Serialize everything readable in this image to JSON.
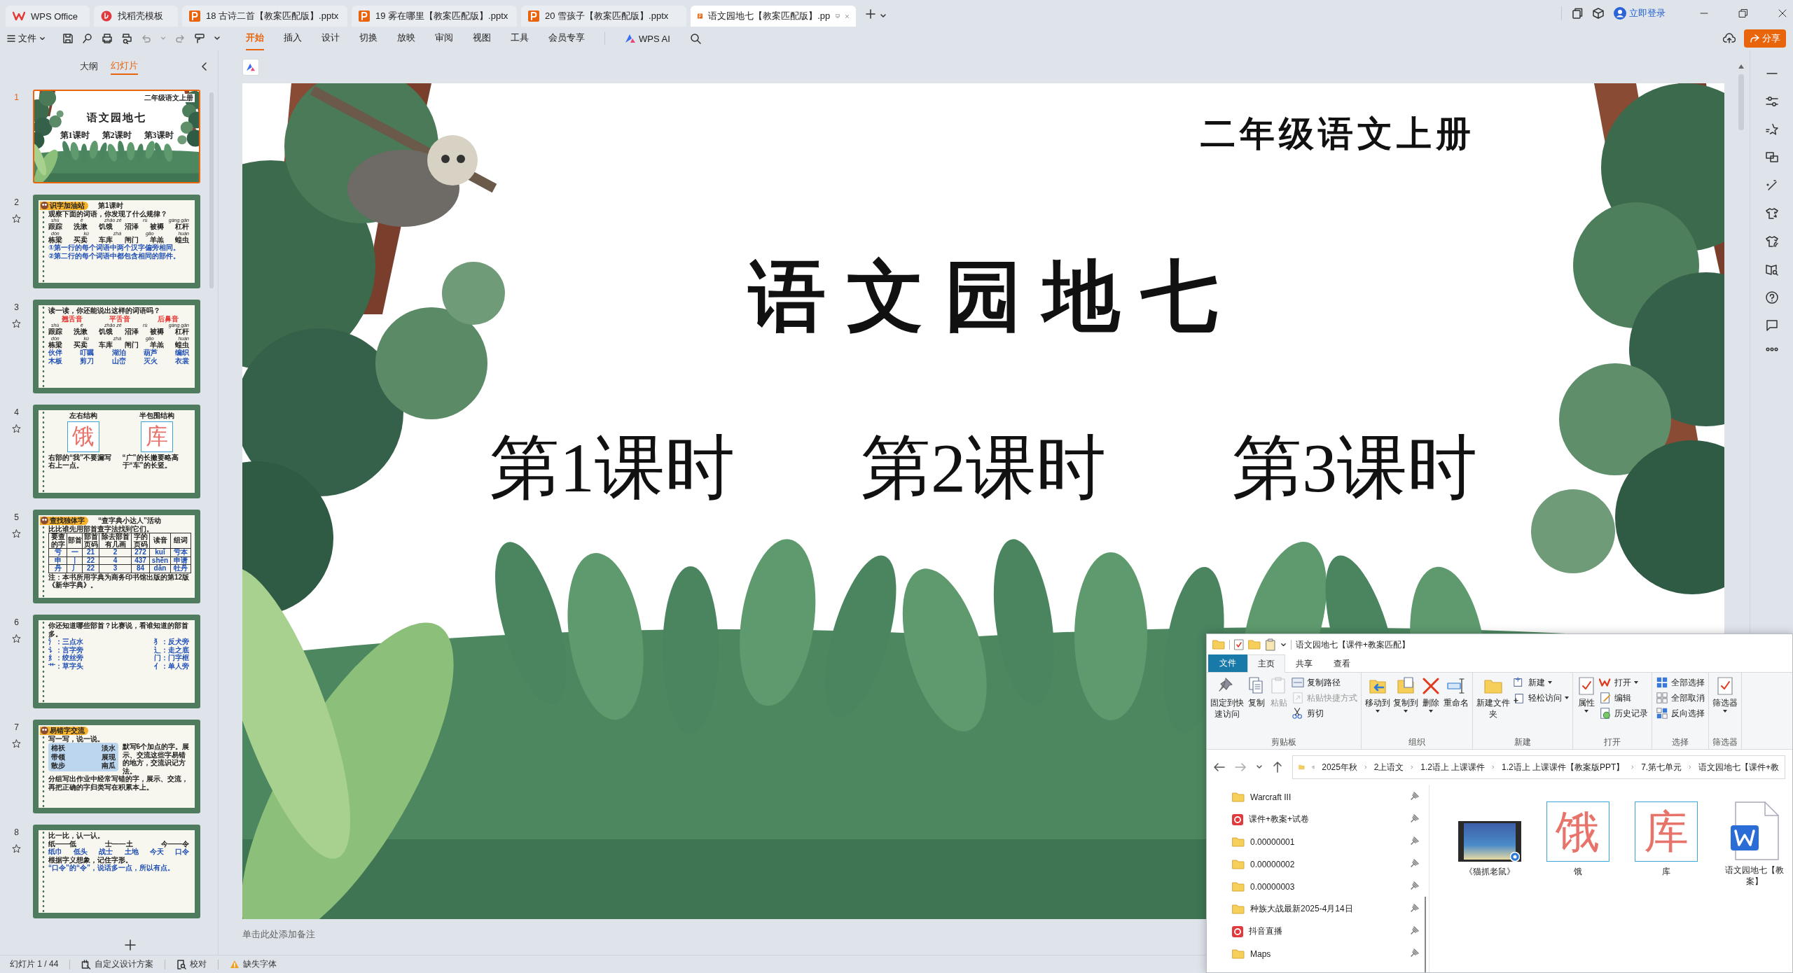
{
  "tabs": [
    {
      "label": "WPS Office",
      "kind": "home",
      "selected": false
    },
    {
      "label": "找稻壳模板",
      "kind": "docer",
      "selected": false
    },
    {
      "label": "18 古诗二首【教案匹配版】.pptx",
      "kind": "pptx",
      "selected": false
    },
    {
      "label": "19 雾在哪里【教案匹配版】.pptx",
      "kind": "pptx",
      "selected": false
    },
    {
      "label": "20 雪孩子【教案匹配版】.pptx",
      "kind": "pptx",
      "selected": false
    },
    {
      "label": "语文园地七【教案匹配版】.pp",
      "kind": "pptx",
      "selected": true
    }
  ],
  "account": {
    "login": "立即登录"
  },
  "menu": {
    "file": "文件",
    "tabs": [
      {
        "label": "开始",
        "selected": true
      },
      {
        "label": "插入",
        "selected": false
      },
      {
        "label": "设计",
        "selected": false
      },
      {
        "label": "切换",
        "selected": false
      },
      {
        "label": "放映",
        "selected": false
      },
      {
        "label": "审阅",
        "selected": false
      },
      {
        "label": "视图",
        "selected": false
      },
      {
        "label": "工具",
        "selected": false
      },
      {
        "label": "会员专享",
        "selected": false
      }
    ],
    "ai": "WPS AI",
    "share": "分享"
  },
  "panel": {
    "tabs": [
      {
        "label": "大纲",
        "selected": false
      },
      {
        "label": "幻灯片",
        "selected": true
      }
    ],
    "slides": [
      {
        "number": "1",
        "selected": true,
        "kind": "cover",
        "blocks": [
          {
            "kind": "corner",
            "text": "二年级语文上册"
          },
          {
            "kind": "title",
            "text": "语文园地七"
          },
          {
            "kind": "row",
            "texts": [
              "第1课时",
              "第2课时",
              "第3课时"
            ]
          }
        ]
      },
      {
        "number": "2",
        "selected": false,
        "kind": "notebook",
        "blocks": [
          {
            "kind": "badge",
            "text": "识字加油站",
            "heading": "第1课时"
          },
          {
            "kind": "text",
            "text": "观察下面的词语，你发现了什么规律？"
          },
          {
            "kind": "pinyin",
            "texts": [
              "shù",
              "è",
              "zhǎo zé",
              "rù",
              "gàng gǎn"
            ]
          },
          {
            "kind": "words",
            "texts": [
              "跟踪",
              "洗漱",
              "饥饿",
              "沼泽",
              "被褥",
              "杠杆"
            ]
          },
          {
            "kind": "pinyin",
            "texts": [
              "dòn",
              "kù",
              "zhá",
              "gāo",
              "huán"
            ]
          },
          {
            "kind": "words",
            "texts": [
              "栋梁",
              "买卖",
              "车库",
              "闸门",
              "羊羔",
              "蝗虫"
            ]
          },
          {
            "kind": "blue",
            "text": "①第一行的每个词语中两个汉字偏旁相同。"
          },
          {
            "kind": "blue",
            "text": "②第二行的每个词语中都包含相同的部件。"
          }
        ]
      },
      {
        "number": "3",
        "selected": false,
        "kind": "notebook",
        "blocks": [
          {
            "kind": "text",
            "text": "读一读，你还能说出这样的词语吗？"
          },
          {
            "kind": "reds",
            "texts": [
              "翘舌音",
              "平舌音",
              "后鼻音"
            ]
          },
          {
            "kind": "pinyin",
            "texts": [
              "shù",
              "è",
              "zhǎo zé",
              "rù",
              "gàng gǎn"
            ]
          },
          {
            "kind": "words",
            "texts": [
              "跟踪",
              "洗漱",
              "饥饿",
              "沼泽",
              "被褥",
              "杠杆"
            ]
          },
          {
            "kind": "pinyin",
            "texts": [
              "dòn",
              "kù",
              "zhá",
              "gāo",
              "huán"
            ]
          },
          {
            "kind": "words",
            "texts": [
              "栋梁",
              "买卖",
              "车库",
              "闸门",
              "羊羔",
              "蝗虫"
            ]
          },
          {
            "kind": "bluewords",
            "texts": [
              "伙伴",
              "叮嘱",
              "湖泊",
              "葫芦",
              "编织"
            ]
          },
          {
            "kind": "bluewords",
            "texts": [
              "木板",
              "剪刀",
              "山峦",
              "灭火",
              "衣裳"
            ]
          }
        ]
      },
      {
        "number": "4",
        "selected": false,
        "kind": "notebook",
        "blocks": [
          {
            "kind": "columns",
            "columns": [
              [
                {
                  "kind": "heading",
                  "text": "左右结构"
                },
                {
                  "kind": "charbox",
                  "text": "饿"
                },
                {
                  "kind": "text",
                  "text": "右部的“我”不要漏写右上一点。"
                }
              ],
              [
                {
                  "kind": "heading",
                  "text": "半包围结构"
                },
                {
                  "kind": "charbox",
                  "text": "库"
                },
                {
                  "kind": "text",
                  "text": "“广”的长撇要略高于“车”的长竖。"
                }
              ]
            ]
          }
        ]
      },
      {
        "number": "5",
        "selected": false,
        "kind": "notebook",
        "blocks": [
          {
            "kind": "badge",
            "text": "查找独体字",
            "heading": "“查字典小达人”活动"
          },
          {
            "kind": "text",
            "text": "比比谁先用部首查字法找到它们。"
          },
          {
            "kind": "table",
            "rows": [
              [
                "要查的字",
                "部首",
                "部首页码",
                "除去部首有几画",
                "字的页码",
                "读音",
                "组词"
              ],
              [
                "亏",
                "一",
                "21",
                "2",
                "272",
                "kuī",
                "亏本"
              ],
              [
                "申",
                "丨",
                "22",
                "4",
                "437",
                "shēn",
                "申请"
              ],
              [
                "丹",
                "丿",
                "22",
                "3",
                "84",
                "dān",
                "牡丹"
              ]
            ]
          },
          {
            "kind": "text",
            "text": "注：本书所用字典为商务印书馆出版的第12版《新华字典》。"
          }
        ]
      },
      {
        "number": "6",
        "selected": false,
        "kind": "notebook",
        "blocks": [
          {
            "kind": "text",
            "text": "你还知道哪些部首？比赛说，看谁知道的部首多。"
          },
          {
            "kind": "bluewords",
            "texts": [
              "氵：三点水",
              "犭：反犬旁"
            ]
          },
          {
            "kind": "bluewords",
            "texts": [
              "讠：言字旁",
              "辶：走之底"
            ]
          },
          {
            "kind": "bluewords",
            "texts": [
              "纟：绞丝旁",
              "门：门字框"
            ]
          },
          {
            "kind": "bluewords",
            "texts": [
              "艹：草字头",
              "亻：单人旁"
            ]
          }
        ]
      },
      {
        "number": "7",
        "selected": false,
        "kind": "notebook",
        "blocks": [
          {
            "kind": "badge",
            "text": "易错字交流"
          },
          {
            "kind": "text",
            "text": "写一写，说一说。"
          },
          {
            "kind": "columns",
            "columns": [
              [
                {
                  "kind": "wordbox",
                  "rows": [
                    [
                      "棉袄",
                      "淡水"
                    ],
                    [
                      "带领",
                      "展现"
                    ],
                    [
                      "散步",
                      "南瓜"
                    ]
                  ]
                }
              ],
              [
                {
                  "kind": "text",
                  "text": "默写6个加点的字。展示、交流这些字易错的地方，交流识记方法。"
                }
              ]
            ]
          },
          {
            "kind": "text",
            "text": "分组写出作业中经常写错的字，展示、交流，再把正确的字归类写在积累本上。"
          }
        ]
      },
      {
        "number": "8",
        "selected": false,
        "kind": "notebook",
        "blocks": [
          {
            "kind": "text",
            "text": "比一比，认一认。"
          },
          {
            "kind": "words",
            "texts": [
              "纸——低",
              "士——土",
              "今——令"
            ]
          },
          {
            "kind": "bluewords",
            "texts": [
              "纸巾",
              "低头",
              "战士",
              "土地",
              "今天",
              "口令"
            ]
          },
          {
            "kind": "text",
            "text": "根据字义想象，记住字形。"
          },
          {
            "kind": "blue",
            "text": "“口令”的“令”，说话多一点，所以有点。"
          }
        ]
      }
    ]
  },
  "slide": {
    "subtitle": "二年级语文上册",
    "title": "语文园地七",
    "lessons": [
      "第1课时",
      "第2课时",
      "第3课时"
    ]
  },
  "notes": {
    "placeholder": "单击此处添加备注"
  },
  "status_bar": {
    "slide_count": "幻灯片 1 / 44",
    "design": "自定义设计方案",
    "proofread": "校对",
    "missing_fonts": "缺失字体"
  },
  "explorer": {
    "title": "语文园地七【课件+教案匹配】",
    "file_button": "文件",
    "tabs": [
      {
        "label": "主页",
        "selected": true
      },
      {
        "label": "共享",
        "selected": false
      },
      {
        "label": "查看",
        "selected": false
      }
    ],
    "groups": [
      {
        "label": "剪贴板",
        "items": [
          {
            "label": "固定到快速访问",
            "kind": "large",
            "disabled": false,
            "menu": false
          },
          {
            "label": "复制",
            "kind": "large",
            "disabled": false,
            "menu": false
          },
          {
            "label": "粘贴",
            "kind": "large",
            "disabled": true,
            "menu": false
          },
          {
            "label": "复制路径",
            "kind": "small",
            "disabled": false,
            "menu": false
          },
          {
            "label": "粘贴快捷方式",
            "kind": "small",
            "disabled": true,
            "menu": false
          },
          {
            "label": "剪切",
            "kind": "small",
            "disabled": false,
            "menu": false
          }
        ]
      },
      {
        "label": "组织",
        "items": [
          {
            "label": "移动到",
            "kind": "large",
            "disabled": false,
            "menu": true
          },
          {
            "label": "复制到",
            "kind": "large",
            "disabled": false,
            "menu": true
          },
          {
            "label": "删除",
            "kind": "large",
            "disabled": false,
            "menu": true
          },
          {
            "label": "重命名",
            "kind": "large",
            "disabled": false,
            "menu": false
          }
        ]
      },
      {
        "label": "新建",
        "items": [
          {
            "label": "新建文件夹",
            "kind": "large",
            "disabled": false,
            "menu": false
          },
          {
            "label": "新建",
            "kind": "small",
            "disabled": false,
            "menu": true
          },
          {
            "label": "轻松访问",
            "kind": "small",
            "disabled": false,
            "menu": true
          }
        ]
      },
      {
        "label": "打开",
        "items": [
          {
            "label": "属性",
            "kind": "large",
            "disabled": false,
            "menu": true
          },
          {
            "label": "打开",
            "kind": "small",
            "disabled": false,
            "menu": true
          },
          {
            "label": "编辑",
            "kind": "small",
            "disabled": false,
            "menu": false
          },
          {
            "label": "历史记录",
            "kind": "small",
            "disabled": false,
            "menu": false
          }
        ]
      },
      {
        "label": "选择",
        "items": [
          {
            "label": "全部选择",
            "kind": "small",
            "disabled": false,
            "menu": false
          },
          {
            "label": "全部取消",
            "kind": "small",
            "disabled": false,
            "menu": false
          },
          {
            "label": "反向选择",
            "kind": "small",
            "disabled": false,
            "menu": false
          }
        ]
      },
      {
        "label": "筛选器",
        "items": [
          {
            "label": "筛选器",
            "kind": "large",
            "disabled": false,
            "menu": true
          }
        ]
      }
    ],
    "path": [
      "2025年秋",
      "2上语文",
      "1.2语上 上课课件",
      "1.2语上 上课课件【教案版PPT】",
      "7.第七单元",
      "语文园地七【课件+教"
    ],
    "nav": [
      {
        "label": "Warcraft III",
        "kind": "folder"
      },
      {
        "label": "课件+教案+试卷",
        "kind": "app"
      },
      {
        "label": "0.00000001",
        "kind": "folder"
      },
      {
        "label": "0.00000002",
        "kind": "folder"
      },
      {
        "label": "0.00000003",
        "kind": "folder"
      },
      {
        "label": "种族大战最新2025-4月14日",
        "kind": "folder"
      },
      {
        "label": "抖音直播",
        "kind": "app"
      },
      {
        "label": "Maps",
        "kind": "folder"
      }
    ],
    "files": [
      {
        "label": "《猫抓老鼠》",
        "kind": "video"
      },
      {
        "label": "饿",
        "kind": "image",
        "glyph": "饿"
      },
      {
        "label": "库",
        "kind": "image",
        "glyph": "库"
      },
      {
        "label": "语文园地七【教案】",
        "kind": "doc"
      }
    ]
  }
}
